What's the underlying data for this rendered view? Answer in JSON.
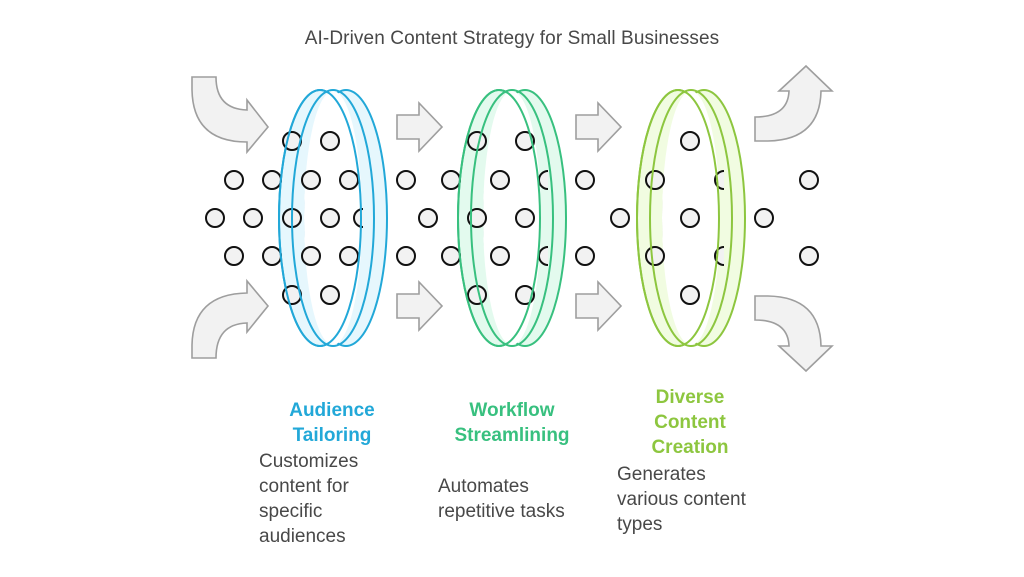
{
  "title": "AI-Driven Content Strategy for Small Businesses",
  "colors": {
    "arrow_fill": "#f2f2f2",
    "arrow_stroke": "#9e9e9e",
    "dot_fill": "#f2f2f2",
    "dot_stroke": "#111111",
    "text": "#484848"
  },
  "icons": {
    "input_arrows": [
      "curved-arrow-down-right-icon",
      "curved-arrow-up-right-icon"
    ],
    "transition_arrows": "right-arrow-icon",
    "output_arrows": [
      "curved-arrow-up-icon",
      "curved-arrow-down-icon"
    ],
    "items": "circle-dot-icon",
    "filters": "ring-filter-icon"
  },
  "stages": [
    {
      "title_lines": [
        "Audience",
        "Tailoring"
      ],
      "description_lines": [
        "Customizes",
        "content for",
        "specific",
        "audiences"
      ],
      "color": "#22a8d8",
      "ring_fill": "#e6f7fd"
    },
    {
      "title_lines": [
        "Workflow",
        "Streamlining"
      ],
      "description_lines": [
        "Automates",
        "repetitive tasks"
      ],
      "color": "#38c07f",
      "ring_fill": "#e3faee"
    },
    {
      "title_lines": [
        "Diverse",
        "Content",
        "Creation"
      ],
      "description_lines": [
        "Generates",
        "various content",
        "types"
      ],
      "color": "#8dc63f",
      "ring_fill": "#f1fce1"
    }
  ]
}
